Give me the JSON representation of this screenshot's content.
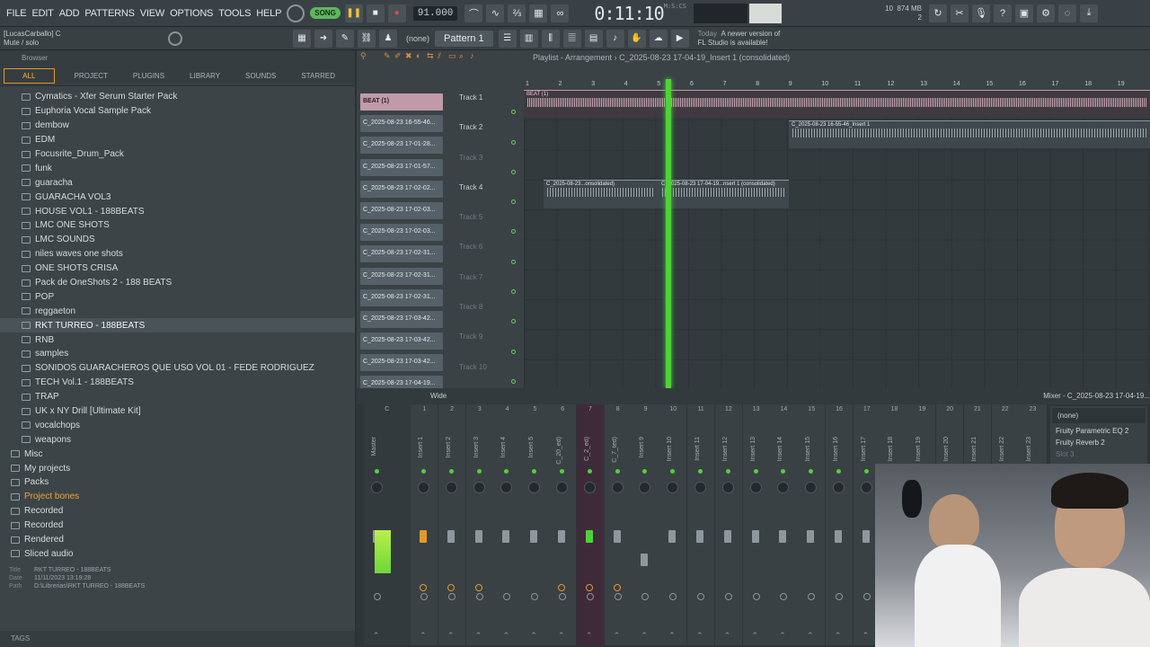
{
  "menu": [
    "FILE",
    "EDIT",
    "ADD",
    "PATTERNS",
    "VIEW",
    "OPTIONS",
    "TOOLS",
    "HELP"
  ],
  "transport": {
    "mode_label": "SONG",
    "tempo": "91.000",
    "time": "0:11:10",
    "time_unit": "M:S:CS"
  },
  "system": {
    "memory_value": "874 MB",
    "cpu_value": "10",
    "voices": "2"
  },
  "hint": {
    "line1": "[LucasCarballo] C",
    "line2": "Mute / solo"
  },
  "toolbar2": {
    "none_label": "(none)",
    "pattern_label": "Pattern 1"
  },
  "news": {
    "line1_prefix": "Today",
    "line1_text": "A newer version of",
    "line2": "FL Studio is available!"
  },
  "browser": {
    "title": "Browser",
    "tabs": [
      "ALL",
      "PROJECT",
      "PLUGINS",
      "LIBRARY",
      "SOUNDS",
      "STARRED"
    ],
    "items": [
      {
        "label": "Cymatics - Xfer Serum Starter Pack",
        "indent": 2
      },
      {
        "label": "Euphoria Vocal Sample Pack",
        "indent": 2
      },
      {
        "label": "dembow",
        "indent": 2
      },
      {
        "label": "EDM",
        "indent": 2
      },
      {
        "label": "Focusrite_Drum_Pack",
        "indent": 2
      },
      {
        "label": "funk",
        "indent": 2
      },
      {
        "label": "guaracha",
        "indent": 2
      },
      {
        "label": "GUARACHA VOL3",
        "indent": 2
      },
      {
        "label": "HOUSE VOL1 - 188BEATS",
        "indent": 2
      },
      {
        "label": "LMC ONE SHOTS",
        "indent": 2
      },
      {
        "label": "LMC SOUNDS",
        "indent": 2
      },
      {
        "label": "niles waves one shots",
        "indent": 2
      },
      {
        "label": "ONE SHOTS CRISA",
        "indent": 2
      },
      {
        "label": "Pack de OneShots 2 - 188 BEATS",
        "indent": 2
      },
      {
        "label": "POP",
        "indent": 2
      },
      {
        "label": "reggaeton",
        "indent": 2
      },
      {
        "label": "RKT  TURREO - 188BEATS",
        "indent": 2,
        "selected": true
      },
      {
        "label": "RNB",
        "indent": 2
      },
      {
        "label": "samples",
        "indent": 2
      },
      {
        "label": "SONIDOS GUARACHEROS QUE USO VOL 01 - FEDE RODRIGUEZ",
        "indent": 2
      },
      {
        "label": "TECH Vol.1 - 188BEATS",
        "indent": 2
      },
      {
        "label": "TRAP",
        "indent": 2
      },
      {
        "label": "UK x NY Drill [Ultimate Kit]",
        "indent": 2
      },
      {
        "label": "vocalchops",
        "indent": 2
      },
      {
        "label": "weapons",
        "indent": 2
      },
      {
        "label": "Misc",
        "indent": 1
      },
      {
        "label": "My projects",
        "indent": 1
      },
      {
        "label": "Packs",
        "indent": 1
      },
      {
        "label": "Project bones",
        "indent": 1,
        "orange": true
      },
      {
        "label": "Recorded",
        "indent": 1
      },
      {
        "label": "Recorded",
        "indent": 1
      },
      {
        "label": "Rendered",
        "indent": 1
      },
      {
        "label": "Sliced audio",
        "indent": 1
      }
    ],
    "info": {
      "title_key": "Title",
      "title_val": "RKT  TURREO - 188BEATS",
      "date_key": "Date",
      "date_val": "11/11/2023 13:19:28",
      "path_key": "Path",
      "path_val": "D:\\Librerias\\RKT  TURREO - 188BEATS"
    },
    "tags_label": "TAGS"
  },
  "playlist": {
    "title": "Playlist - Arrangement",
    "subtitle": "C_2025-08-23 17-04-19_Insert 1 (consolidated)",
    "clips": [
      "BEAT (1)",
      "C_2025-08-23 16-55-46...",
      "C_2025-08-23 17-01-28...",
      "C_2025-08-23 17-01-57...",
      "C_2025-08-23 17-02-02...",
      "C_2025-08-23 17-02-03...",
      "C_2025-08-23 17-02-03...",
      "C_2025-08-23 17-02-31...",
      "C_2025-08-23 17-02-31...",
      "C_2025-08-23 17-02-31...",
      "C_2025-08-23 17-03-42...",
      "C_2025-08-23 17-03-42...",
      "C_2025-08-23 17-03-42...",
      "C_2025-08-23 17-04-19..."
    ],
    "tracks": [
      "Track 1",
      "Track 2",
      "Track 3",
      "Track 4",
      "Track 5",
      "Track 6",
      "Track 7",
      "Track 8",
      "Track 9",
      "Track 10"
    ],
    "ruler": [
      "1",
      "2",
      "3",
      "4",
      "5",
      "6",
      "7",
      "8",
      "9",
      "10",
      "11",
      "12",
      "13",
      "14",
      "15",
      "16",
      "17",
      "18",
      "19"
    ],
    "placed_clips": {
      "beat": "BEAT (1)",
      "insert1": "C_2025-08-23 16-55-46_Insert 1",
      "consolidated_a": "C_2025-08-23...onsolidated)",
      "consolidated_b": "C_2025-08-23 17-04-19...nsert 1 (consolidated)"
    }
  },
  "mixer": {
    "view_label": "Wide",
    "title": "Mixer - C_2025-08-23 17-04-19...",
    "strips": [
      {
        "num": "C",
        "name": "Master"
      },
      {
        "num": "1",
        "name": "Insert 1"
      },
      {
        "num": "2",
        "name": "Insert 2"
      },
      {
        "num": "3",
        "name": "Insert 3"
      },
      {
        "num": "4",
        "name": "Insert 4"
      },
      {
        "num": "5",
        "name": "Insert 5"
      },
      {
        "num": "6",
        "name": "C_20_ed)"
      },
      {
        "num": "7",
        "name": "C_2_ed)"
      },
      {
        "num": "8",
        "name": "C_7_ted)"
      },
      {
        "num": "9",
        "name": "Insert 9"
      },
      {
        "num": "10",
        "name": "Insert 10"
      },
      {
        "num": "11",
        "name": "Insert 11"
      },
      {
        "num": "12",
        "name": "Insert 12"
      },
      {
        "num": "13",
        "name": "Insert 13"
      },
      {
        "num": "14",
        "name": "Insert 14"
      },
      {
        "num": "15",
        "name": "Insert 15"
      },
      {
        "num": "16",
        "name": "Insert 16"
      },
      {
        "num": "17",
        "name": "Insert 17"
      },
      {
        "num": "18",
        "name": "Insert 18"
      },
      {
        "num": "19",
        "name": "Insert 19"
      },
      {
        "num": "20",
        "name": "Insert 20"
      },
      {
        "num": "21",
        "name": "Insert 21"
      },
      {
        "num": "22",
        "name": "Insert 22"
      },
      {
        "num": "23",
        "name": "Insert 23"
      }
    ],
    "insert_none": "(none)",
    "insert_slots": [
      "Fruity Parametric EQ 2",
      "Fruity Reverb 2",
      "Slot 3"
    ]
  },
  "colors": {
    "accent_orange": "#e09a2a",
    "playhead_green": "#4fd13a",
    "beat_clip": "#c09aa8"
  }
}
